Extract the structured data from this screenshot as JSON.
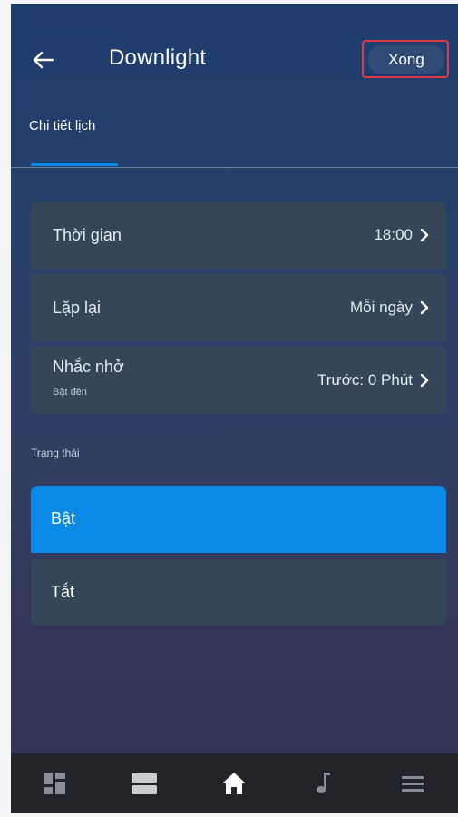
{
  "header": {
    "title": "Downlight",
    "done_label": "Xong"
  },
  "tabs": [
    {
      "label": "Chi tiết lịch",
      "active": true
    }
  ],
  "settings": [
    {
      "label": "Thời gian",
      "value": "18:00"
    },
    {
      "label": "Lặp lại",
      "value": "Mỗi ngày"
    },
    {
      "label": "Nhắc nhở",
      "sublabel": "Bật đèn",
      "value": "Trước: 0 Phút"
    }
  ],
  "status": {
    "section_label": "Trạng thái",
    "options": [
      {
        "label": "Bật",
        "selected": true
      },
      {
        "label": "Tắt",
        "selected": false
      }
    ]
  },
  "bottom_nav": [
    {
      "icon": "dashboard-icon"
    },
    {
      "icon": "list-view-icon"
    },
    {
      "icon": "home-icon",
      "active": true
    },
    {
      "icon": "music-note-icon"
    },
    {
      "icon": "menu-icon"
    }
  ],
  "colors": {
    "accent": "#0a8ae6",
    "highlight_outline": "#e03a44",
    "card_background": "#344658"
  }
}
